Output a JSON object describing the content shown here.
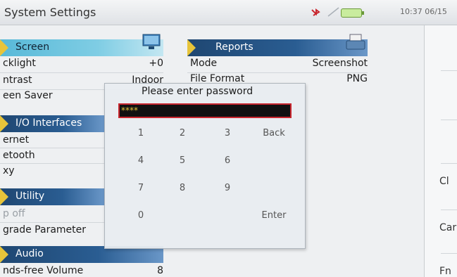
{
  "titlebar": {
    "title": "System Settings",
    "clock": "10:37 06/15"
  },
  "screen_panel": {
    "header": "Screen",
    "rows": [
      {
        "label": "cklight",
        "value": "+0"
      },
      {
        "label": "ntrast",
        "value": "Indoor"
      },
      {
        "label": "een Saver",
        "value": ""
      }
    ]
  },
  "io_panel": {
    "header": "I/O Interfaces",
    "rows": [
      {
        "label": "ernet"
      },
      {
        "label": "etooth"
      },
      {
        "label": "xy"
      }
    ]
  },
  "utility_panel": {
    "header": "Utility",
    "rows": [
      {
        "label": "p off"
      },
      {
        "label": "grade Parameter"
      }
    ]
  },
  "audio_panel": {
    "header": "Audio",
    "rows": [
      {
        "label": "nds-free Volume",
        "value": "8"
      }
    ]
  },
  "reports_panel": {
    "header": "Reports",
    "rows": [
      {
        "label": "Mode",
        "value": "Screenshot"
      },
      {
        "label": "File Format",
        "value": "PNG"
      }
    ]
  },
  "dialog": {
    "title": "Please enter password",
    "password_value": "****",
    "keys": [
      "1",
      "2",
      "3",
      "Back",
      "4",
      "5",
      "6",
      "7",
      "8",
      "9",
      "0",
      "Enter"
    ]
  },
  "side_buttons": [
    "Cl",
    "Car",
    "Fn"
  ],
  "icons": {
    "bluetooth": "bluetooth-icon",
    "wifi": "wifi-icon",
    "battery": "battery-icon",
    "screen": "monitor-icon",
    "reports": "printer-icon"
  },
  "colors": {
    "header_blue": "#1f4772",
    "header_cyan": "#58b9d8",
    "wedge": "#e7c43a",
    "password_border": "#c8262e"
  }
}
